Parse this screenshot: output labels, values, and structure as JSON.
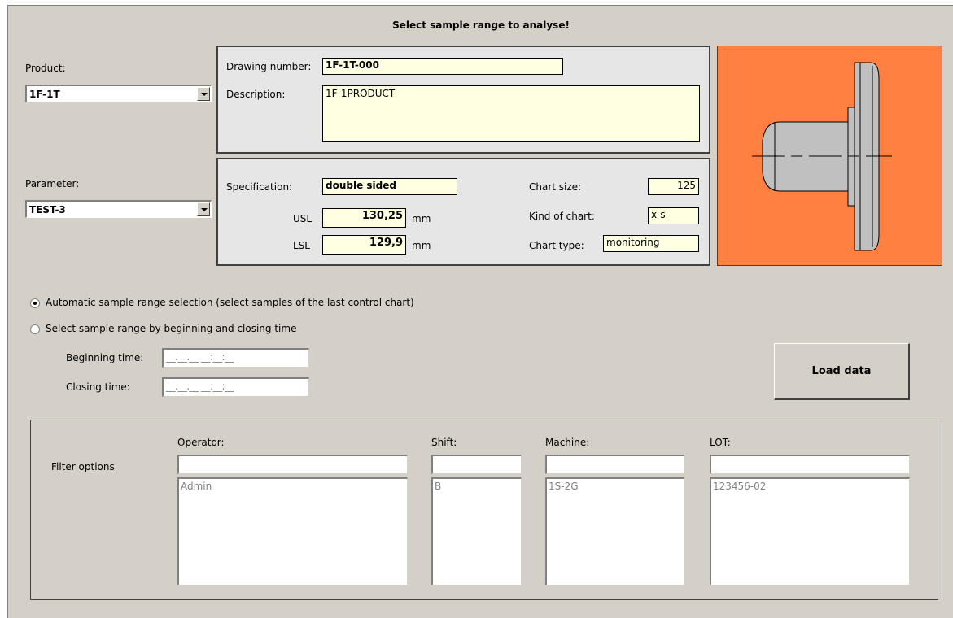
{
  "title": "Select sample range to analyse!",
  "product": {
    "label": "Product:",
    "value": "1F-1T"
  },
  "parameter": {
    "label": "Parameter:",
    "value": "TEST-3"
  },
  "drawing": {
    "number_label": "Drawing number:",
    "number_value": "1F-1T-000",
    "description_label": "Description:",
    "description_value": "1F-1PRODUCT"
  },
  "spec": {
    "specification_label": "Specification:",
    "specification_value": "double sided",
    "usl_label": "USL",
    "usl_value": "130,25",
    "lsl_label": "LSL",
    "lsl_value": "129,9",
    "unit": "mm",
    "chart_size_label": "Chart size:",
    "chart_size_value": "125",
    "kind_label": "Kind of chart:",
    "kind_value": "x-s",
    "type_label": "Chart type:",
    "type_value": "monitoring"
  },
  "range": {
    "auto_label": "Automatic sample range selection (select samples of the last control chart)",
    "auto_selected": true,
    "manual_label": "Select sample range by beginning and closing time",
    "beginning_label": "Beginning time:",
    "closing_label": "Closing time:",
    "time_mask": "__.__.__ __:__:__"
  },
  "load_button": "Load data",
  "filter": {
    "label": "Filter options",
    "operator_label": "Operator:",
    "operator_items": [
      "Admin"
    ],
    "shift_label": "Shift:",
    "shift_items": [
      "B"
    ],
    "machine_label": "Machine:",
    "machine_items": [
      "1S-2G"
    ],
    "lot_label": "LOT:",
    "lot_items": [
      "123456-02"
    ]
  },
  "colors": {
    "background": "#d4d0c8",
    "field_yellow": "#ffffe1",
    "image_orange": "#ff8040"
  },
  "icons": [
    "dropdown-arrow-icon",
    "part-drawing-image"
  ]
}
